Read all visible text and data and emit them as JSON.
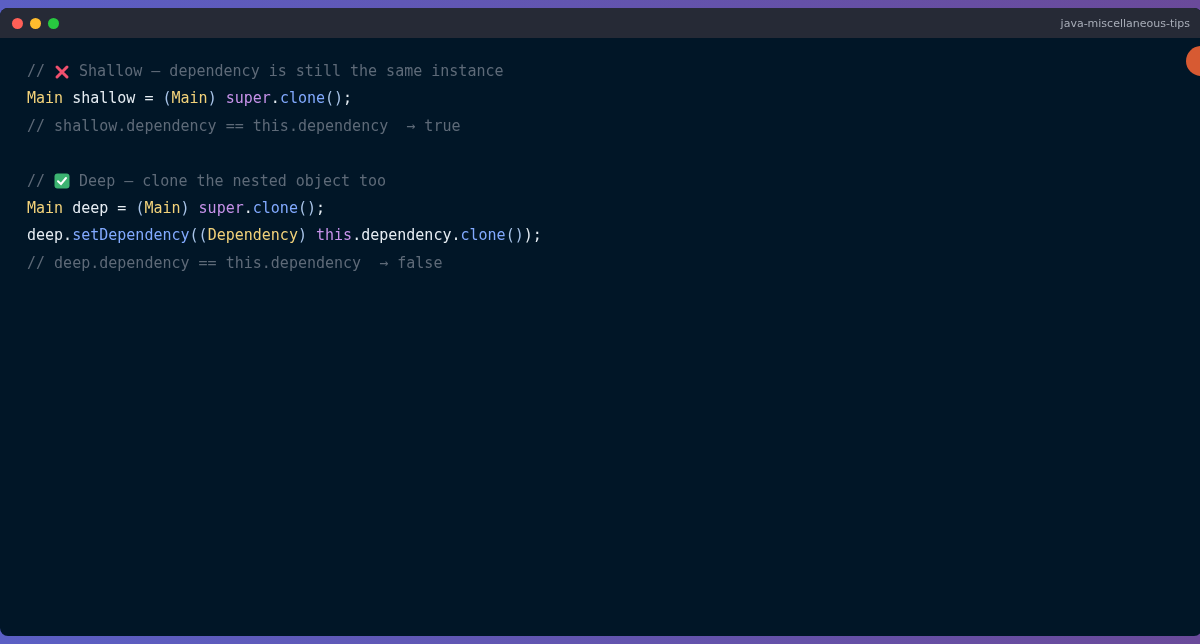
{
  "window": {
    "title": "java-miscellaneous-tips"
  },
  "code": [
    {
      "kind": "bad",
      "prefix": "//",
      "text": "Shallow — dependency is still the same instance"
    },
    {
      "kind": "code",
      "tokens": [
        {
          "kind": "type",
          "text": "Main"
        },
        {
          "kind": "plain",
          "text": " shallow = "
        },
        {
          "kind": "punct",
          "text": "("
        },
        {
          "kind": "type",
          "text": "Main"
        },
        {
          "kind": "punct",
          "text": ")"
        },
        {
          "kind": "keyword",
          "text": " super"
        },
        {
          "kind": "plain",
          "text": "."
        },
        {
          "kind": "method",
          "text": "clone"
        },
        {
          "kind": "punct",
          "text": "()"
        },
        {
          "kind": "plain",
          "text": ";"
        }
      ]
    },
    {
      "kind": "comment",
      "text": "// shallow.dependency == this.dependency  → true"
    },
    {
      "kind": "blank"
    },
    {
      "kind": "good",
      "prefix": "//",
      "text": "Deep — clone the nested object too"
    },
    {
      "kind": "code",
      "tokens": [
        {
          "kind": "type",
          "text": "Main"
        },
        {
          "kind": "plain",
          "text": " deep = "
        },
        {
          "kind": "punct",
          "text": "("
        },
        {
          "kind": "type",
          "text": "Main"
        },
        {
          "kind": "punct",
          "text": ")"
        },
        {
          "kind": "keyword",
          "text": " super"
        },
        {
          "kind": "plain",
          "text": "."
        },
        {
          "kind": "method",
          "text": "clone"
        },
        {
          "kind": "punct",
          "text": "()"
        },
        {
          "kind": "plain",
          "text": ";"
        }
      ]
    },
    {
      "kind": "code",
      "tokens": [
        {
          "kind": "plain",
          "text": "deep."
        },
        {
          "kind": "method",
          "text": "setDependency"
        },
        {
          "kind": "punct",
          "text": "(("
        },
        {
          "kind": "type",
          "text": "Dependency"
        },
        {
          "kind": "punct",
          "text": ")"
        },
        {
          "kind": "keyword",
          "text": " this"
        },
        {
          "kind": "plain",
          "text": ".dependency."
        },
        {
          "kind": "method",
          "text": "clone"
        },
        {
          "kind": "punct",
          "text": "()"
        },
        {
          "kind": "plain",
          "text": ");"
        }
      ]
    },
    {
      "kind": "comment",
      "text": "// deep.dependency == this.dependency  → false"
    }
  ]
}
